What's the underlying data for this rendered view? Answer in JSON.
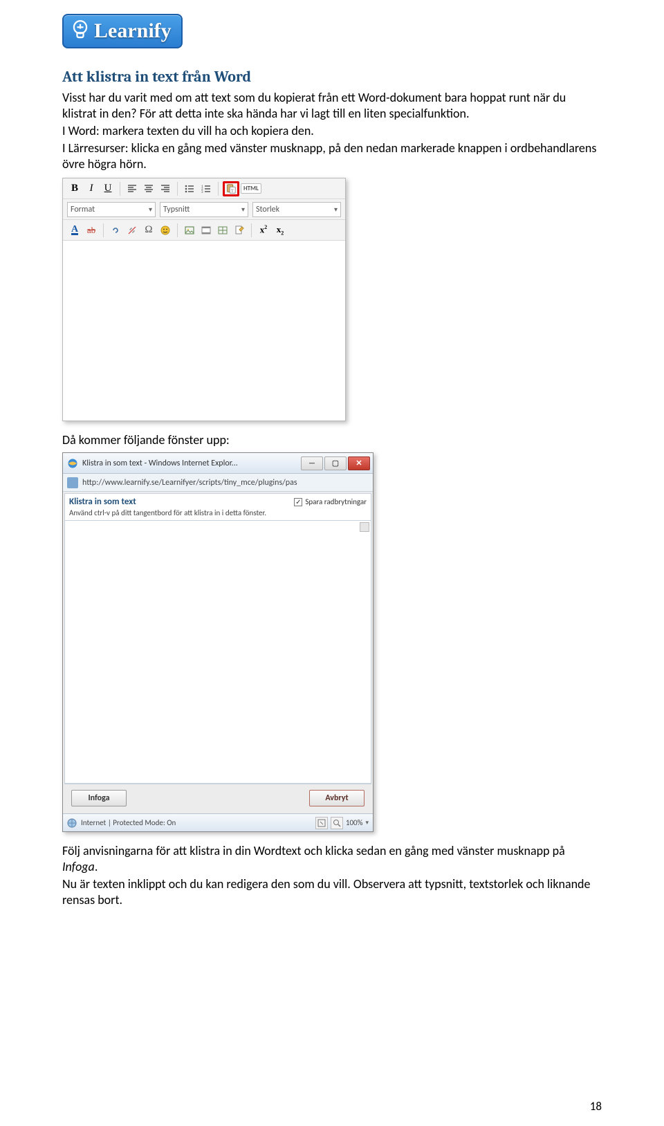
{
  "logo": {
    "text": "Learnify"
  },
  "heading": "Att klistra in text från Word",
  "para1": "Visst har du varit med om att text som du kopierat från ett Word-dokument bara hoppat runt när du klistrat in den? För att detta inte ska hända har vi lagt till en liten specialfunktion.",
  "para2": "I Word: markera texten du vill ha och kopiera den.",
  "para3": "I Lärresurser: klicka en gång med vänster musknapp, på den nedan markerade knappen i ordbehandlarens övre högra hörn.",
  "toolbar": {
    "format_label": "Format",
    "font_label": "Typsnitt",
    "size_label": "Storlek",
    "html_label": "HTML"
  },
  "mid_para": "Då kommer följande fönster upp:",
  "dialog": {
    "window_title": "Klistra in som text - Windows Internet Explor...",
    "url": "http://www.learnify.se/Learnifyer/scripts/tiny_mce/plugins/pas",
    "panel_title": "Klistra in som text",
    "checkbox_label": "Spara radbrytningar",
    "instruction": "Använd ctrl-v på ditt tangentbord för att klistra in i detta fönster.",
    "insert_btn": "Infoga",
    "cancel_btn": "Avbryt",
    "status_text": "Internet | Protected Mode: On",
    "zoom": "100%"
  },
  "closing1a": "Följ anvisningarna för att klistra in din Wordtext och klicka sedan en gång med vänster musknapp på ",
  "closing1b": "Infoga",
  "closing1c": ".",
  "closing2": "Nu är texten inklippt och du kan redigera den som du vill. Observera att typsnitt, textstorlek och liknande rensas bort.",
  "page_number": "18"
}
